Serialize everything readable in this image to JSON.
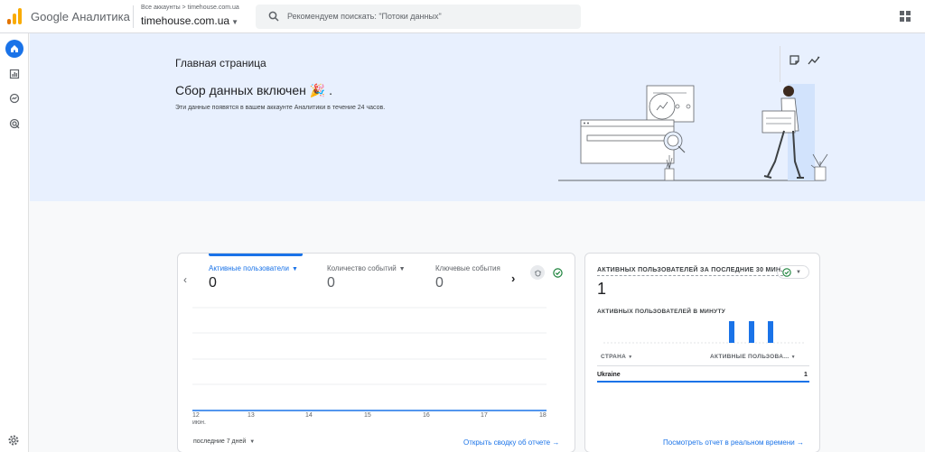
{
  "header": {
    "brand": "Google Аналитика",
    "breadcrumb": "Все аккаунты > timehouse.com.ua",
    "account": "timehouse.com.ua",
    "search_placeholder": "Рекомендуем поискать: \"Потоки данных\""
  },
  "hero": {
    "title": "Главная страница",
    "headline": "Сбор данных включен 🎉 .",
    "description": "Эти данные появятся в вашем аккаунте Аналитики в течение 24 часов."
  },
  "metrics_card": {
    "metrics": [
      {
        "label": "Активные пользователи",
        "value": "0"
      },
      {
        "label": "Количество событий",
        "value": "0"
      },
      {
        "label": "Ключевые события",
        "value": "0"
      }
    ],
    "x_ticks": [
      "12",
      "13",
      "14",
      "15",
      "16",
      "17",
      "18"
    ],
    "x_tick_sub": "июн.",
    "period": "последние 7 дней",
    "link": "Открыть сводку об отчете →"
  },
  "realtime_card": {
    "title": "АКТИВНЫХ ПОЛЬЗОВАТЕЛЕЙ ЗА ПОСЛЕДНИЕ 30 МИН.",
    "value": "1",
    "subtitle": "АКТИВНЫХ ПОЛЬЗОВАТЕЛЕЙ В МИНУТУ",
    "col_country": "СТРАНА",
    "col_users": "АКТИВНЫЕ ПОЛЬЗОВА...",
    "rows": [
      {
        "country": "Ukraine",
        "users": "1"
      }
    ],
    "link": "Посмотреть отчет в реальном времени →"
  },
  "colors": {
    "accent": "#1a73e8",
    "success": "#188038",
    "hero_bg": "#e8f0fe"
  }
}
